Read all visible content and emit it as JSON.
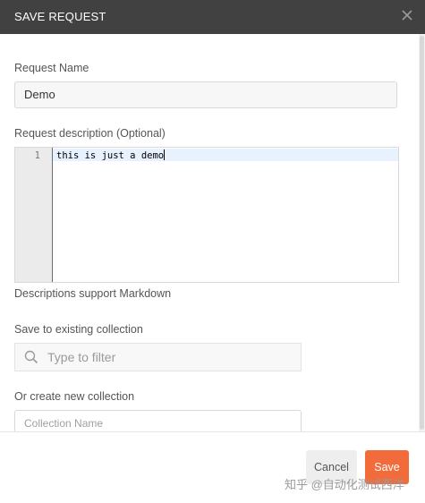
{
  "dialog": {
    "title": "SAVE REQUEST",
    "close_icon": "close-icon"
  },
  "request_name": {
    "label": "Request Name",
    "value": "Demo"
  },
  "description": {
    "label": "Request description (Optional)",
    "line_number": "1",
    "text": "this is just a demo",
    "help": "Descriptions support Markdown"
  },
  "existing_collection": {
    "label": "Save to existing collection",
    "placeholder": "Type to filter",
    "icon": "search-icon"
  },
  "new_collection": {
    "label": "Or create new collection",
    "placeholder": "Collection Name"
  },
  "footer": {
    "cancel_label": "Cancel",
    "save_label": "Save"
  },
  "watermark": "知乎 @自动化测试西洋",
  "colors": {
    "titlebar": "#414141",
    "save_button": "#f26b3a",
    "active_line": "#e8f2fe"
  }
}
